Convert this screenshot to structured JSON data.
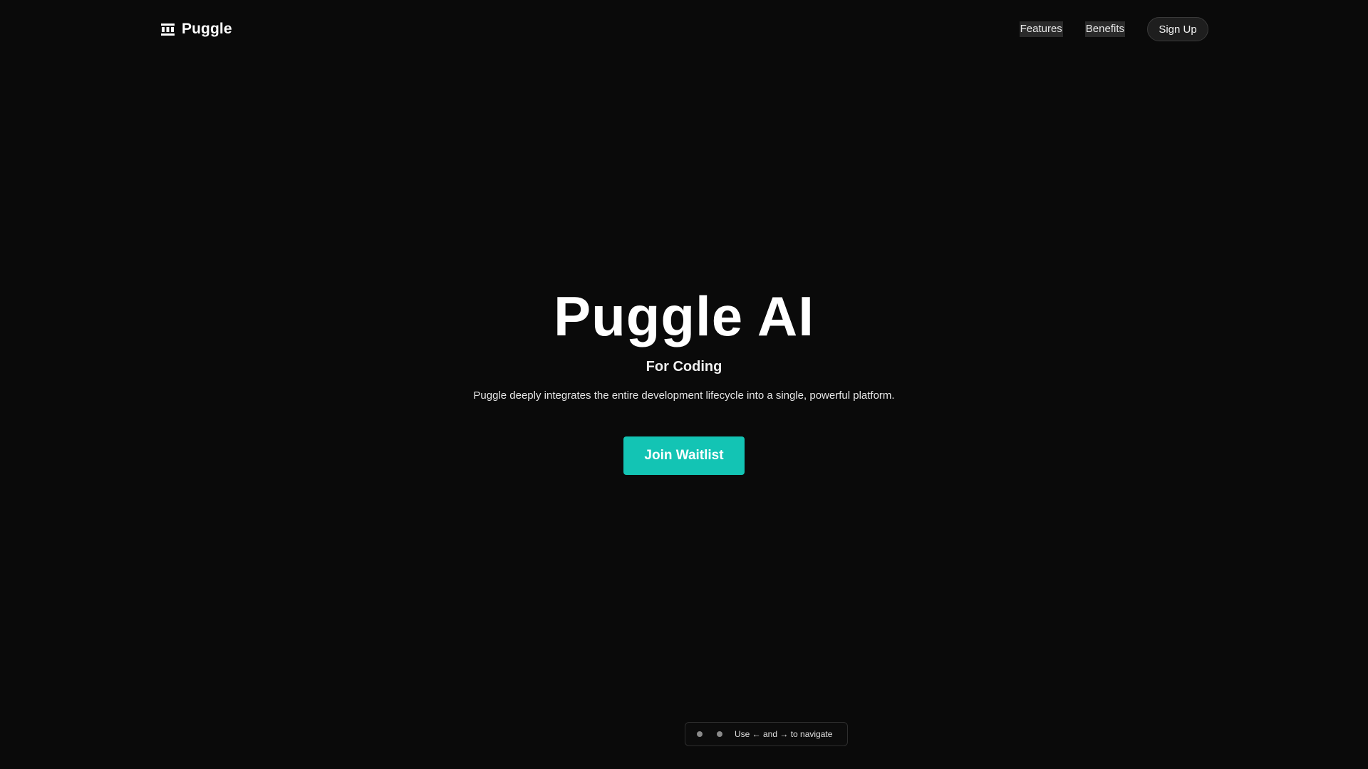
{
  "header": {
    "brand_name": "Puggle",
    "brand_icon": "grid-logo-icon",
    "nav": [
      {
        "label": "Features"
      },
      {
        "label": "Benefits"
      }
    ],
    "signup_label": "Sign Up"
  },
  "hero": {
    "title": "Puggle AI",
    "subtitle": "For Coding",
    "description": "Puggle deeply integrates the entire development lifecycle into a single, powerful platform.",
    "cta_label": "Join Waitlist"
  },
  "pager": {
    "hint": "Use ← and → to navigate",
    "slides": 2
  },
  "colors": {
    "background": "#0a0a0a",
    "accent": "#13c4b4",
    "text": "#ffffff"
  }
}
